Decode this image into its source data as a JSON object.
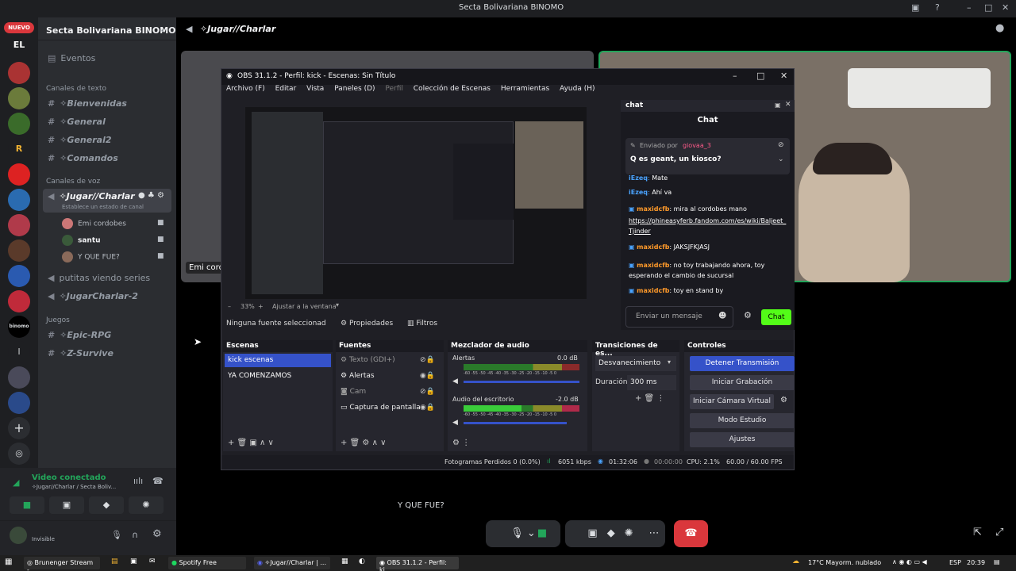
{
  "window_title": "Secta Bolivariana BINOMO",
  "server": {
    "name": "Secta Bolivariana BINOMO",
    "new_badge": "NUEVO",
    "initials": "EL"
  },
  "sidebar": {
    "events": "Eventos",
    "text_category": "Canales de texto",
    "text_channels": [
      "✧Bienvenidas",
      "✧General",
      "✧General2",
      "✧Comandos"
    ],
    "voice_category": "Canales de voz",
    "active_voice": "✧Jugar//Charlar",
    "status_hint": "Establece un estado de canal",
    "voice_users": [
      "Emi cordobes",
      "santu",
      "Y QUE FUE?"
    ],
    "other_voice": [
      "putitas viendo series",
      "✧JugarCharlar-2"
    ],
    "games_category": "Juegos",
    "games_channels": [
      "✧Epic-RPG",
      "✧Z-Survive"
    ]
  },
  "voice_status": {
    "title": "Video conectado",
    "subtitle": "✧Jugar//Charlar / Secta Boliv...",
    "user_status": "Invisible"
  },
  "channel_header": "✧Jugar//Charlar",
  "stream_labels": {
    "left_tile": "Emi cord",
    "bottom_name": "Y QUE FUE?"
  },
  "obs": {
    "title": "OBS 31.1.2 - Perfil: kick - Escenas: Sin Título",
    "menu": [
      "Archivo (F)",
      "Editar",
      "Vista",
      "Paneles (D)",
      "Perfil",
      "Colección de Escenas",
      "Herramientas",
      "Ayuda (H)"
    ],
    "zoom": "33%",
    "fit": "Ajustar a la ventana",
    "no_source": "Ninguna fuente seleccionad",
    "properties": "Propiedades",
    "filters": "Filtros",
    "scenes_title": "Escenas",
    "scenes": [
      "kick escenas",
      "YA COMENZAMOS"
    ],
    "sources_title": "Fuentes",
    "sources": [
      "Texto (GDI+)",
      "Alertas",
      "Cam",
      "Captura de pantalla"
    ],
    "mixer_title": "Mezclador de audio",
    "mixer": [
      {
        "name": "Alertas",
        "db": "0.0 dB"
      },
      {
        "name": "Audio del escritorio",
        "db": "-2.0 dB"
      }
    ],
    "mixer_scale": "-60 -55 -50 -45 -40 -35 -30 -25 -20 -15 -10 -5 0",
    "transitions_title": "Transiciones de es...",
    "transition": "Desvanecimiento",
    "duration_label": "Duración",
    "duration": "300 ms",
    "controls_title": "Controles",
    "controls": [
      "Detener Transmisión",
      "Iniciar Grabación",
      "Iniciar Cámara Virtual",
      "Modo Estudio",
      "Ajustes"
    ],
    "status": {
      "dropped": "Fotogramas Perdidos 0 (0.0%)",
      "kbps": "6051 kbps",
      "time1": "01:32:06",
      "time2": "00:00:00",
      "cpu": "CPU: 2.1%",
      "fps": "60.00 / 60.00 FPS"
    }
  },
  "chat": {
    "dock_title": "chat",
    "header": "Chat",
    "pinned_by": "Enviado por",
    "pinned_user": "giovaa_3",
    "pinned_msg": "Q es geant, un kiosco?",
    "messages": [
      {
        "user": "iEzeq",
        "text": "Mate"
      },
      {
        "user": "iEzeq",
        "text": "Ahí va"
      },
      {
        "user": "maxidcfb",
        "text": "mira al cordobes mano"
      },
      {
        "user": "",
        "text": "https://phineasyferb.fandom.com/es/wiki/Baljeet_Tjinder"
      },
      {
        "user": "maxidcfb",
        "text": "JAKSJFKJASJ"
      },
      {
        "user": "maxidcfb",
        "text": "no toy trabajando ahora, toy esperando el cambio de sucursal"
      },
      {
        "user": "maxidcfb",
        "text": "toy en stand by"
      }
    ],
    "input_placeholder": "Enviar un mensaje",
    "send": "Chat"
  },
  "taskbar": {
    "items": [
      "Brunenger Stream - ...",
      "Spotify Free",
      "✧Jugar//Charlar | ...",
      "OBS 31.1.2 - Perfil: ki..."
    ],
    "weather": "17°C  Mayorm. nublado",
    "lang": "ESP",
    "clock": "20:39"
  },
  "colors": {
    "accent": "#5865f2",
    "green": "#23a55a",
    "red": "#da373c",
    "kick": "#53fc18"
  }
}
